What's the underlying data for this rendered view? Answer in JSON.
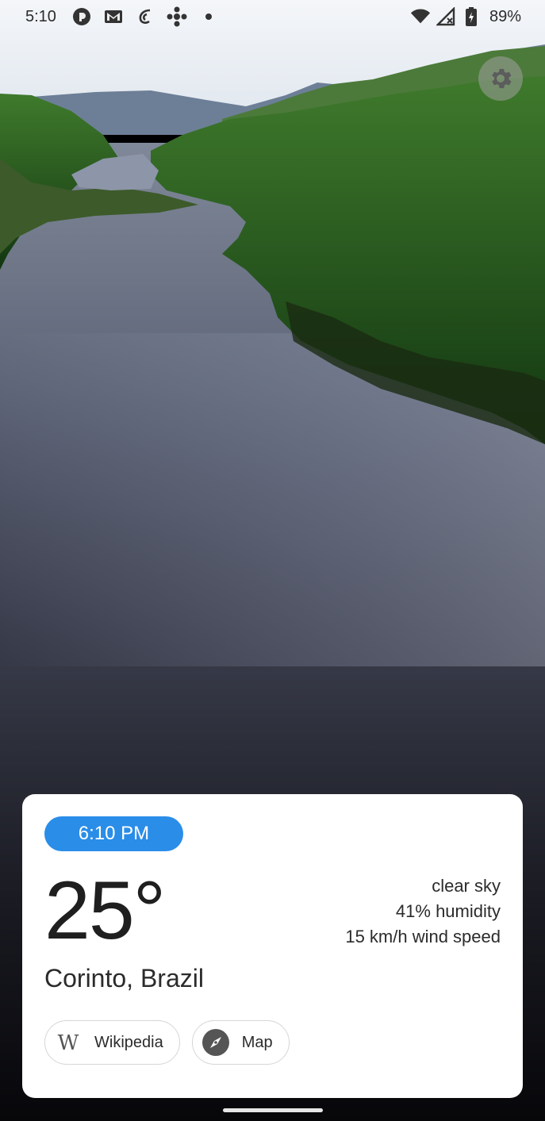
{
  "status_bar": {
    "time": "5:10",
    "left_icons": [
      "pocketcasts-icon",
      "gmail-icon",
      "podcast-icon",
      "cbc-icon",
      "notification-dot-icon"
    ],
    "right_icons": [
      "wifi-icon",
      "signal-icon",
      "battery-icon"
    ],
    "battery_percent": "89%"
  },
  "settings": {
    "icon": "gear-icon"
  },
  "weather_card": {
    "local_time": "6:10 PM",
    "temperature": "25°",
    "condition": "clear sky",
    "humidity": "41% humidity",
    "wind": "15 km/h wind speed",
    "location": "Corinto, Brazil",
    "links": [
      {
        "label": "Wikipedia",
        "icon": "wikipedia-icon"
      },
      {
        "label": "Map",
        "icon": "compass-icon"
      }
    ]
  },
  "colors": {
    "accent": "#2a8de8",
    "card_background": "#ffffff",
    "text": "#2b2b2b"
  }
}
